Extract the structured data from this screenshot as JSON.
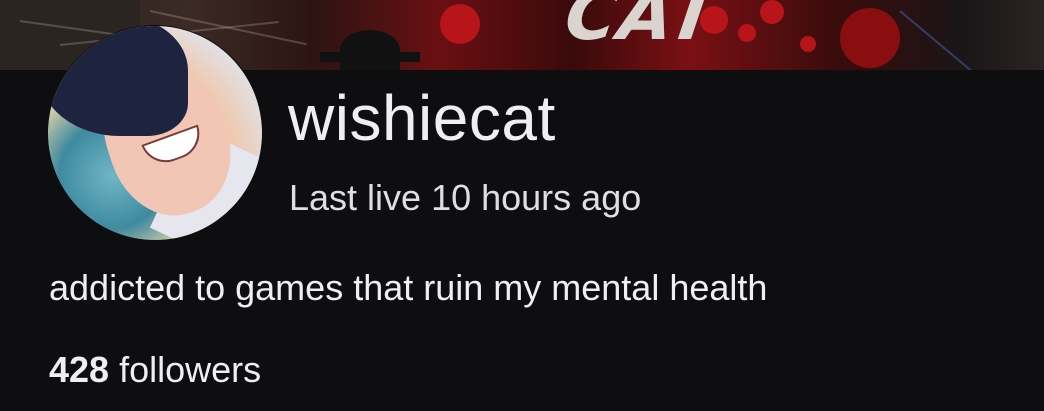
{
  "banner": {
    "text": "CAT",
    "accent_color": "#b8151a"
  },
  "profile": {
    "avatar_icon": "avatar-image",
    "username": "wishiecat",
    "last_live": "Last live 10 hours ago",
    "bio": "addicted to games that ruin my mental health",
    "followers_count": "428",
    "followers_label": "followers"
  },
  "colors": {
    "background": "#0e0e10",
    "text_primary": "#efeff1"
  }
}
